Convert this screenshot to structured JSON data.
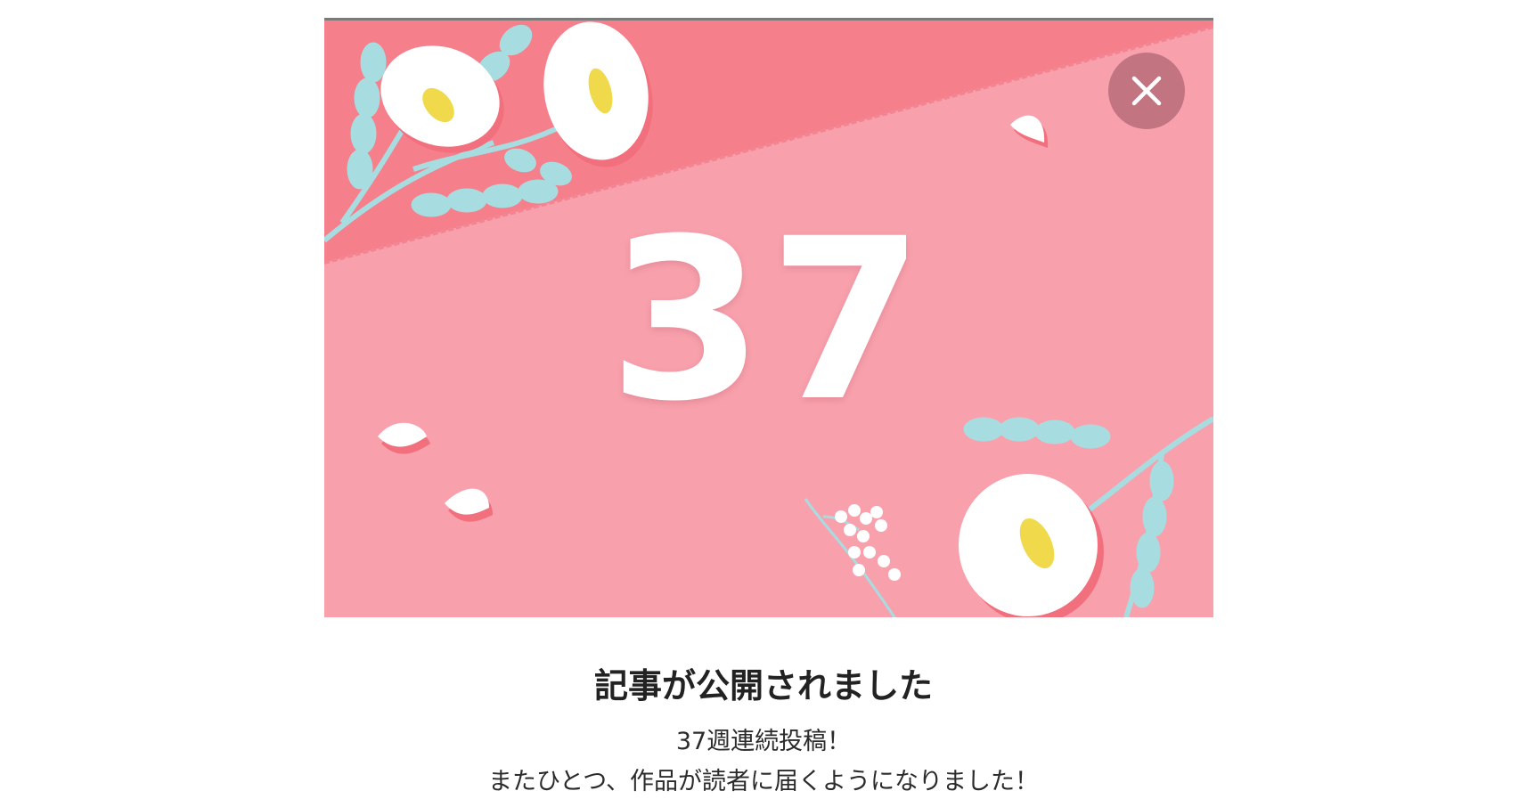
{
  "dialog": {
    "count": "37",
    "title": "記事が公開されました",
    "message_line1": "37週連続投稿！",
    "message_line2": "またひとつ、作品が読者に届くようになりました！",
    "close_icon": "close-icon"
  },
  "colors": {
    "hero_background": "#f8a1ad",
    "hero_band": "#f57f8a",
    "leaf": "#a7dde0",
    "flower": "#ffffff",
    "flower_center": "#f0d94a",
    "text": "#222222"
  }
}
